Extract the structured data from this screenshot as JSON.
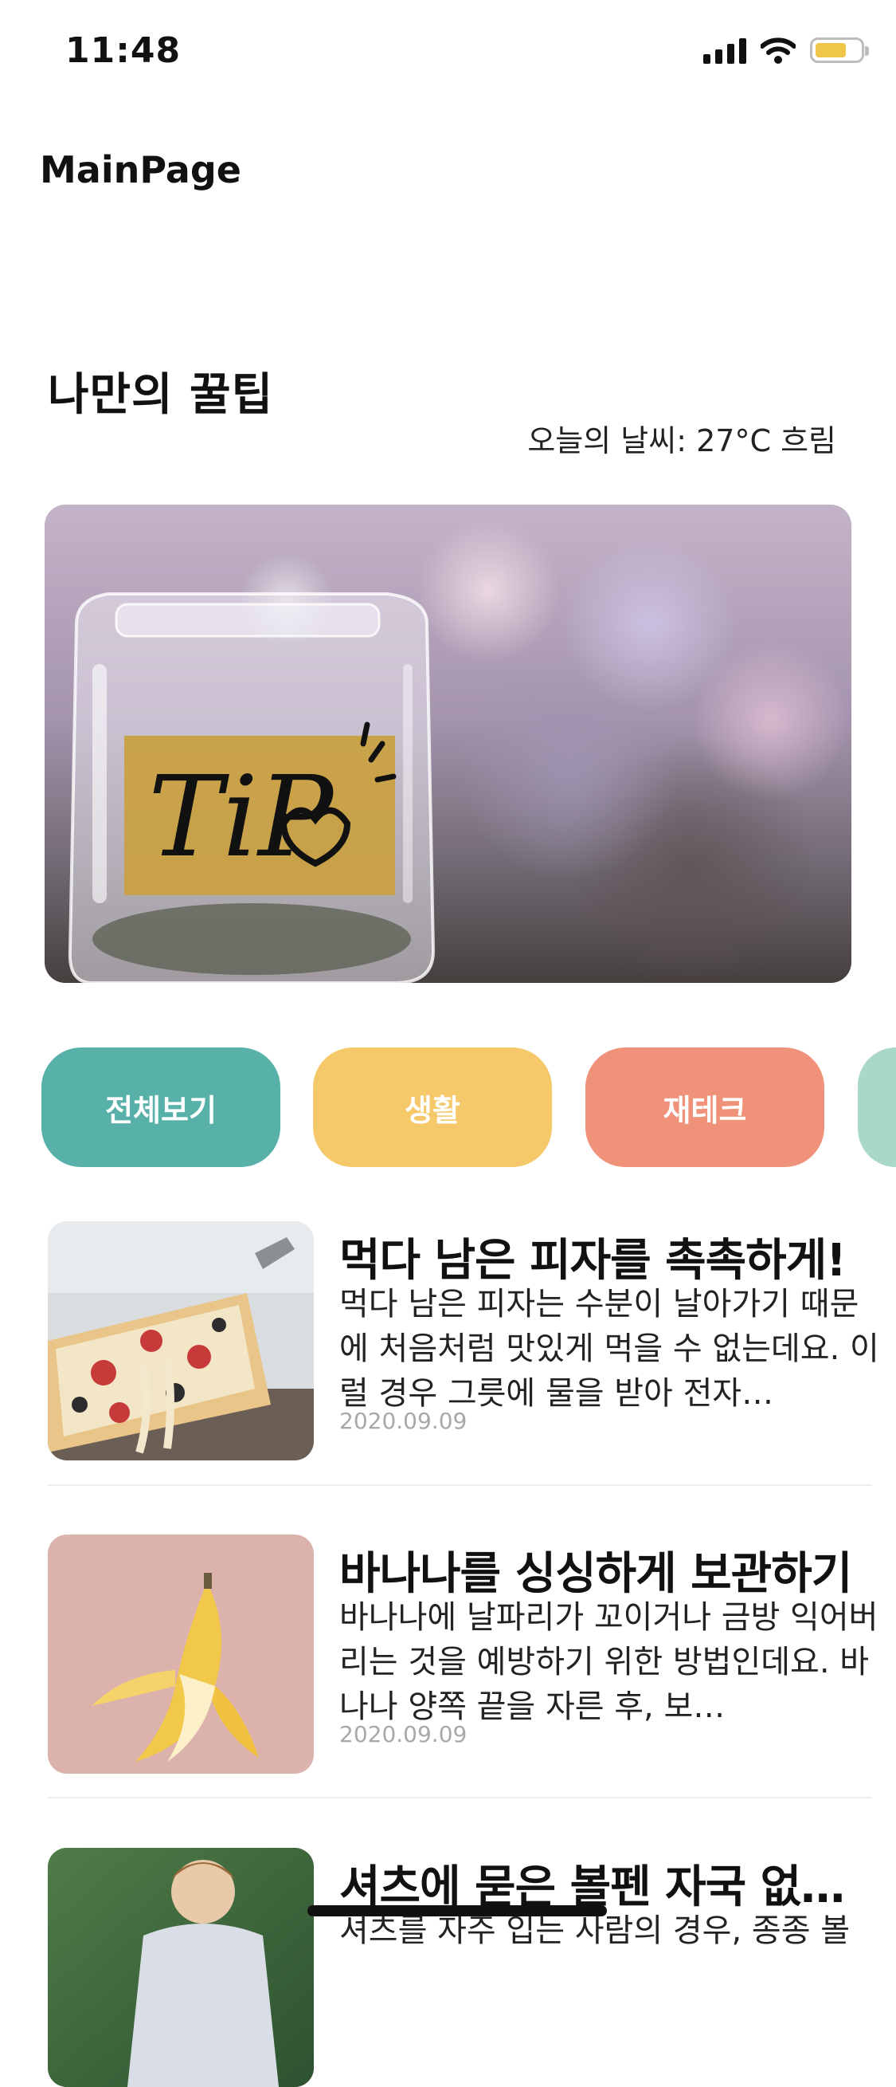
{
  "status_bar": {
    "time": "11:48",
    "battery_color": "#f0c64a"
  },
  "nav": {
    "title": "MainPage"
  },
  "section": {
    "title": "나만의 꿀팁",
    "weather": "오늘의 날씨: 27°C 흐림"
  },
  "hero": {
    "image": "tip-jar-photo",
    "label_text": "TiP"
  },
  "categories": [
    {
      "label": "전체보기",
      "color": "#57b1a8"
    },
    {
      "label": "생활",
      "color": "#f5c86a"
    },
    {
      "label": "재테크",
      "color": "#f0927a"
    },
    {
      "label": "",
      "color": "#a9d9c6"
    }
  ],
  "articles": [
    {
      "title": "먹다 남은 피자를 촉촉하게!",
      "description": "먹다 남은 피자는 수분이 날아가기 때문에 처음처럼 맛있게 먹을 수 없는데요. 이럴 경우 그릇에 물을 받아 전자…",
      "date": "2020.09.09",
      "thumbnail": "pizza-photo"
    },
    {
      "title": "바나나를 싱싱하게 보관하기",
      "description": "바나나에 날파리가 꼬이거나 금방 익어버리는 것을 예방하기 위한 방법인데요. 바나나 양쪽 끝을 자른 후, 보…",
      "date": "2020.09.09",
      "thumbnail": "banana-photo"
    },
    {
      "title": "셔츠에 묻은 볼펜 자국 없…",
      "description": "셔츠를 자주 입는 사람의 경우, 종종 볼",
      "date": "",
      "thumbnail": "boy-shirt-photo"
    }
  ]
}
